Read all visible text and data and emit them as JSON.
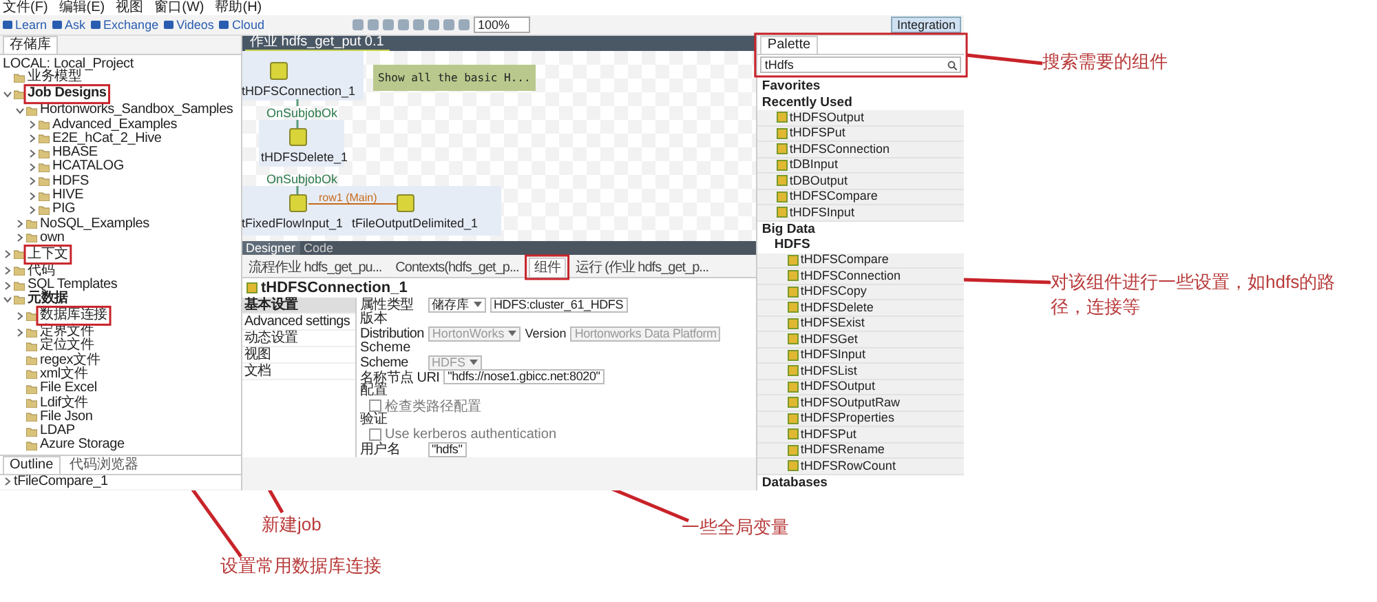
{
  "menu_bar": [
    "文件(F)",
    "编辑(E)",
    "视图",
    "窗口(W)",
    "帮助(H)"
  ],
  "quick_links": [
    "Learn",
    "Ask",
    "Exchange",
    "Videos",
    "Cloud"
  ],
  "toolbar": {
    "zoom": "100%"
  },
  "perspective": "Integration",
  "repository": {
    "tab": "存储库",
    "project": "LOCAL: Local_Project",
    "tree": [
      {
        "label": "业务模型"
      },
      {
        "label": "Job Designs",
        "expanded": true,
        "children": [
          {
            "label": "Hortonworks_Sandbox_Samples",
            "expanded": true,
            "children": [
              {
                "label": "Advanced_Examples",
                "expanded": false
              },
              {
                "label": "E2E_hCat_2_Hive",
                "expanded": false
              },
              {
                "label": "HBASE",
                "expanded": false
              },
              {
                "label": "HCATALOG",
                "expanded": false
              },
              {
                "label": "HDFS",
                "expanded": false
              },
              {
                "label": "HIVE",
                "expanded": false
              },
              {
                "label": "PIG",
                "expanded": false
              }
            ]
          },
          {
            "label": "NoSQL_Examples",
            "expanded": false
          },
          {
            "label": "own",
            "expanded": false
          }
        ]
      },
      {
        "label": "上下文",
        "expanded": false
      },
      {
        "label": "代码",
        "expanded": false
      },
      {
        "label": "SQL Templates",
        "expanded": false
      },
      {
        "label": "元数据",
        "expanded": true,
        "children": [
          {
            "label": "数据库连接",
            "expanded": false
          },
          {
            "label": "定界文件",
            "expanded": false
          },
          {
            "label": "定位文件"
          },
          {
            "label": "regex文件"
          },
          {
            "label": "xml文件"
          },
          {
            "label": "File Excel"
          },
          {
            "label": "Ldif文件"
          },
          {
            "label": "File Json"
          },
          {
            "label": "LDAP"
          },
          {
            "label": "Azure Storage"
          }
        ]
      }
    ]
  },
  "outline": {
    "tabs": [
      {
        "label": "Outline",
        "selected": true
      },
      {
        "label": "代码浏览器",
        "selected": false
      }
    ],
    "items": [
      {
        "label": "tFileCompare_1",
        "expanded": false
      }
    ]
  },
  "editor": {
    "tab": "作业 hdfs_get_put 0.1",
    "note": "Show all the basic H...",
    "triggers": [
      "OnSubjobOk",
      "OnSubjobOk"
    ],
    "flow_label": "row1 (Main)",
    "nodes": [
      {
        "label": "tHDFSConnection_1"
      },
      {
        "label": "tHDFSDelete_1"
      },
      {
        "label": "tFixedFlowInput_1"
      },
      {
        "label": "tFileOutputDelimited_1"
      }
    ],
    "view_tabs": [
      {
        "label": "Designer",
        "selected": true
      },
      {
        "label": "Code",
        "selected": false
      }
    ]
  },
  "bottom_tabs": [
    {
      "label": "流程作业 hdfs_get_pu...",
      "selected": false
    },
    {
      "label": "Contexts(hdfs_get_p...",
      "selected": false
    },
    {
      "label": "组件",
      "selected": true
    },
    {
      "label": "运行 (作业 hdfs_get_p...",
      "selected": false
    }
  ],
  "component": {
    "title": "tHDFSConnection_1",
    "sections": [
      {
        "label": "基本设置",
        "selected": true
      },
      {
        "label": "Advanced settings",
        "selected": false
      },
      {
        "label": "动态设置",
        "selected": false
      },
      {
        "label": "视图",
        "selected": false
      },
      {
        "label": "文档",
        "selected": false
      }
    ],
    "form": [
      {
        "kind": "field",
        "label": "属性类型",
        "select": "储存库",
        "value": "HDFS:cluster_61_HDFS",
        "disabled": false
      },
      {
        "kind": "group",
        "label": "版本"
      },
      {
        "kind": "field",
        "label": "Distribution",
        "select": "HortonWorks",
        "label2": "Version",
        "value": "Hortonworks Data Platform",
        "disabled": true
      },
      {
        "kind": "group",
        "label": "Scheme"
      },
      {
        "kind": "field",
        "label": "Scheme",
        "select": "HDFS",
        "disabled": true
      },
      {
        "kind": "field",
        "label": "名称节点 URI",
        "value": "\"hdfs://nose1.gbicc.net:8020\"",
        "disabled": false
      },
      {
        "kind": "group",
        "label": "配置"
      },
      {
        "kind": "checkbox",
        "label": "检查类路径配置",
        "checked": false
      },
      {
        "kind": "group",
        "label": "验证"
      },
      {
        "kind": "checkbox",
        "label": "Use kerberos authentication",
        "checked": false
      },
      {
        "kind": "field",
        "label": "用户名",
        "value": "\"hdfs\"",
        "disabled": false
      }
    ]
  },
  "palette": {
    "tab": "Palette",
    "search": "tHdfs",
    "groups": [
      {
        "label": "Favorites"
      },
      {
        "label": "Recently Used",
        "items": [
          "tHDFSOutput",
          "tHDFSPut",
          "tHDFSConnection",
          "tDBInput",
          "tDBOutput",
          "tHDFSCompare",
          "tHDFSInput"
        ]
      },
      {
        "label": "Big Data",
        "groups": [
          {
            "label": "HDFS",
            "items": [
              "tHDFSCompare",
              "tHDFSConnection",
              "tHDFSCopy",
              "tHDFSDelete",
              "tHDFSExist",
              "tHDFSGet",
              "tHDFSInput",
              "tHDFSList",
              "tHDFSOutput",
              "tHDFSOutputRaw",
              "tHDFSProperties",
              "tHDFSPut",
              "tHDFSRename",
              "tHDFSRowCount"
            ]
          }
        ]
      },
      {
        "label": "Databases"
      }
    ]
  },
  "annotations": [
    {
      "text": "搜索需要的组件"
    },
    {
      "text": "对该组件进行一些设置，如hdfs的路径，连接等"
    },
    {
      "text": "新建job"
    },
    {
      "text": "一些全局变量"
    },
    {
      "text": "设置常用数据库连接"
    }
  ]
}
